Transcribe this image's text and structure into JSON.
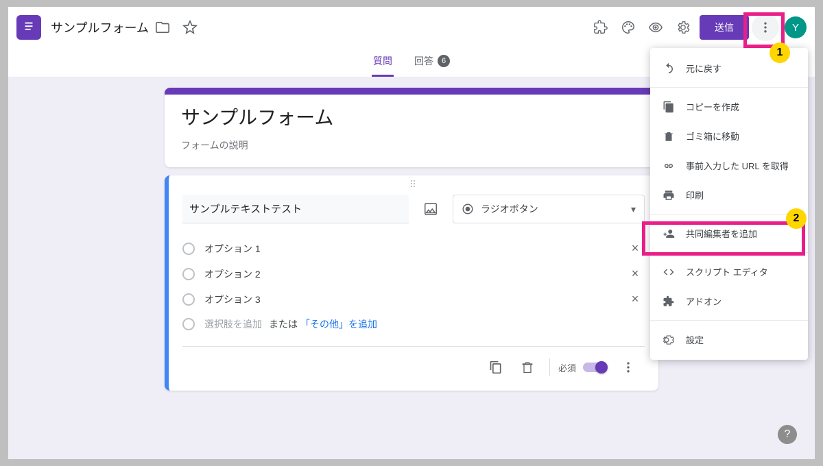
{
  "header": {
    "title": "サンプルフォーム",
    "send_label": "送信",
    "avatar_initial": "Y"
  },
  "tabs": {
    "questions": "質問",
    "responses": "回答",
    "response_count": "6"
  },
  "form": {
    "title": "サンプルフォーム",
    "description": "フォームの説明"
  },
  "question": {
    "title": "サンプルテキストテスト",
    "type_label": "ラジオボタン",
    "options": [
      "オプション 1",
      "オプション 2",
      "オプション 3"
    ],
    "add_option_placeholder": "選択肢を追加",
    "or_label": "または",
    "add_other_label": "「その他」を追加",
    "required_label": "必須"
  },
  "menu": {
    "undo": "元に戻す",
    "copy": "コピーを作成",
    "trash": "ゴミ箱に移動",
    "prefilled": "事前入力した URL を取得",
    "print": "印刷",
    "collaborators": "共同編集者を追加",
    "script": "スクリプト エディタ",
    "addons": "アドオン",
    "settings": "設定"
  },
  "annotations": {
    "n1": "1",
    "n2": "2"
  }
}
